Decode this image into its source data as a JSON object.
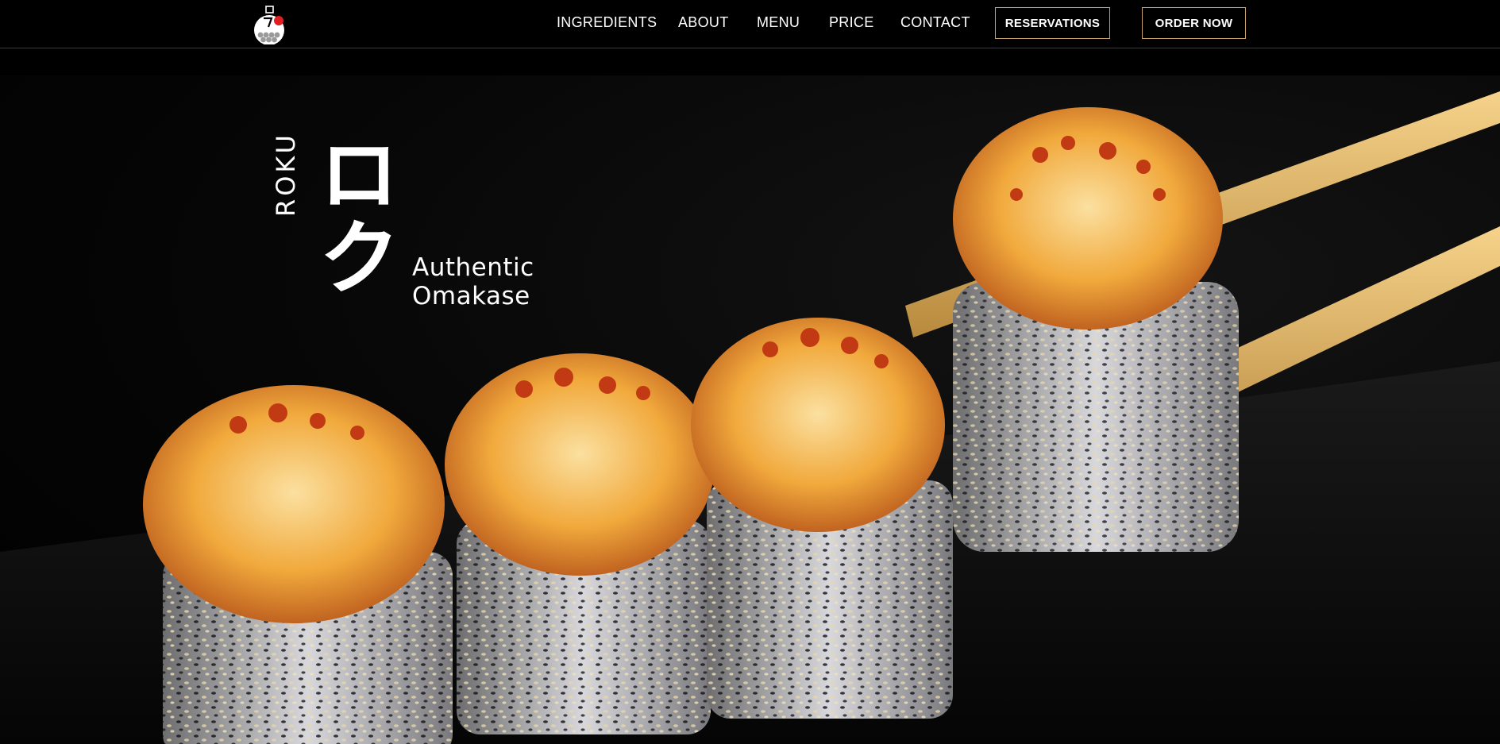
{
  "nav": {
    "links": [
      "INGREDIENTS",
      "ABOUT",
      "MENU",
      "PRICE",
      "CONTACT"
    ],
    "reservations_label": "RESERVATIONS",
    "order_label": "ORDER NOW"
  },
  "hero": {
    "brand_latin": "ROKU",
    "brand_kana": "ロク",
    "tagline_line1": "Authentic",
    "tagline_line2": "Omakase"
  },
  "colors": {
    "background": "#000000",
    "button_border": "#c4a06a",
    "logo_accent": "#e02020",
    "text": "#ffffff"
  }
}
